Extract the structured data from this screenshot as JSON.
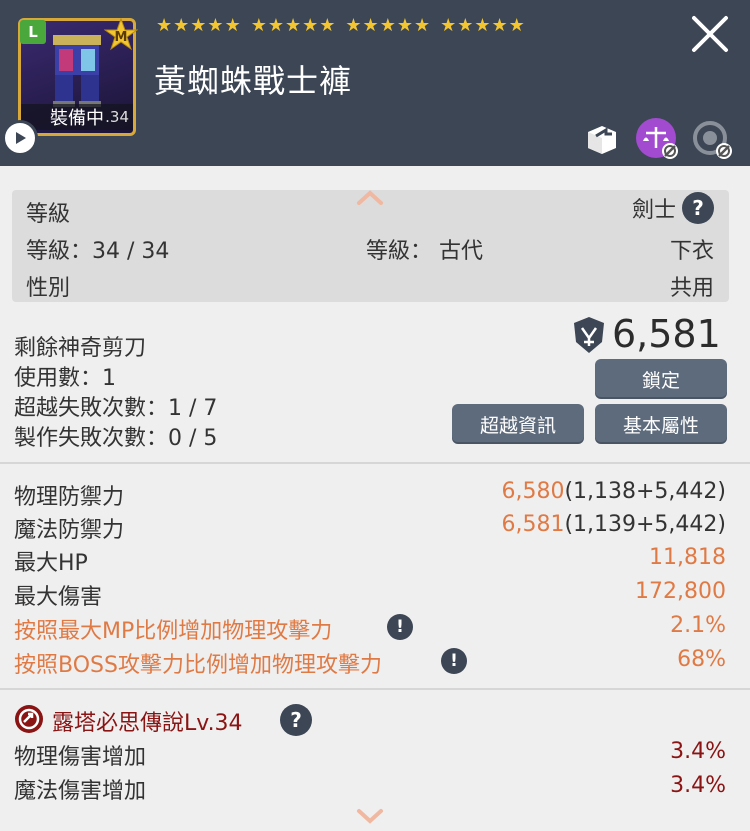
{
  "header": {
    "item_name": "黃蜘蛛戰士褲",
    "badge_l": "L",
    "badge_m": "M",
    "equipped_label": "裝備中",
    "equipped_level": ".34",
    "star_groups": [
      5,
      5,
      5,
      5
    ],
    "star_glyph": "★"
  },
  "info": {
    "level_header": "等級",
    "job": "劍士",
    "level_value": "等級：34 / 34",
    "grade": "等級： 古代",
    "category": "下衣",
    "gender_label": "性別",
    "gender_value": "共用"
  },
  "scissors": {
    "label": "剩餘神奇剪刀",
    "score": "6,581",
    "uses": "使用數：1",
    "transcend_fail": "超越失敗次數：1 / 7",
    "craft_fail": "製作失敗次數：0 / 5",
    "lock_button": "鎖定",
    "transcend_button": "超越資訊",
    "basic_attr_button": "基本屬性"
  },
  "stats": [
    {
      "name": "物理防禦力",
      "value_main": "6,580",
      "value_detail": "(1,138+5,442)"
    },
    {
      "name": "魔法防禦力",
      "value_main": "6,581",
      "value_detail": "(1,139+5,442)"
    },
    {
      "name": "最大HP",
      "value_main": "11,818",
      "value_detail": ""
    },
    {
      "name": "最大傷害",
      "value_main": "172,800",
      "value_detail": ""
    },
    {
      "name": "按照最大MP比例增加物理攻擊力",
      "value_main": "2.1%",
      "value_detail": ""
    },
    {
      "name": "按照BOSS攻擊力比例增加物理攻擊力",
      "value_main": "68%",
      "value_detail": ""
    }
  ],
  "set": {
    "name": "露塔必思傳說Lv.34",
    "effects": [
      {
        "name": "物理傷害增加",
        "value": "3.4%"
      },
      {
        "name": "魔法傷害增加",
        "value": "3.4%"
      }
    ]
  },
  "colors": {
    "header_bg": "#3c4654",
    "orange": "#e07a45",
    "dark_red": "#8a1414",
    "button": "#5d6b7d",
    "star": "#f2c531"
  }
}
